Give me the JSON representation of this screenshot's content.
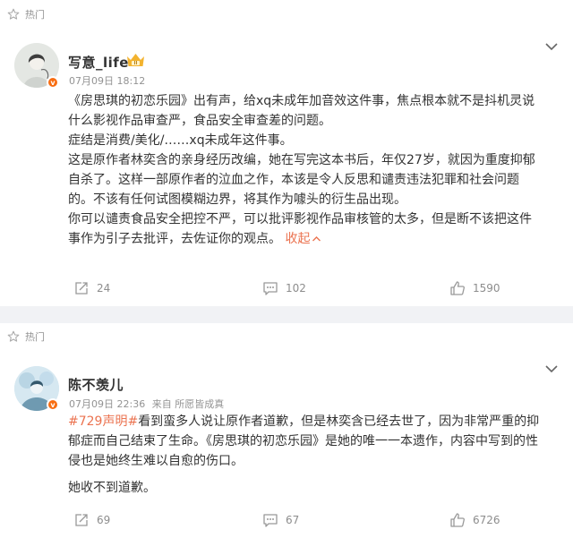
{
  "post1": {
    "hot_label": "热门",
    "username": "写意_life",
    "level_badge": "II",
    "timestamp": "07月09日 18:12",
    "paragraphs": [
      "《房思琪的初恋乐园》出有声，给xq未成年加音效这件事，焦点根本就不是抖机灵说什么影视作品审查严，食品安全审查差的问题。",
      "症结是消费/美化/……xq未成年这件事。",
      "这是原作者林奕含的亲身经历改编，她在写完这本书后，年仅27岁，就因为重度抑郁自杀了。这样一部原作者的泣血之作，本该是令人反思和谴责违法犯罪和社会问题的。不该有任何试图模糊边界，将其作为噱头的衍生品出现。",
      "你可以谴责食品安全把控不严，可以批评影视作品审核管的太多，但是断不该把这件事作为引子去批评，去佐证你的观点。"
    ],
    "fold_label": "收起",
    "reposts": "24",
    "comments": "102",
    "likes": "1590"
  },
  "post2": {
    "hot_label": "热门",
    "username": "陈不羡儿",
    "timestamp": "07月09日 22:36",
    "source": "来自 所愿皆成真",
    "hashtag": "#729声明#",
    "paragraph1_rest": "看到蛮多人说让原作者道歉，但是林奕含已经去世了，因为非常严重的抑郁症而自己结束了生命。《房思琪的初恋乐园》是她的唯一一本遗作，内容中写到的性侵也是她终生难以自愈的伤口。",
    "paragraph2": "她收不到道歉。",
    "reposts": "69",
    "comments": "67",
    "likes": "6726"
  },
  "colors": {
    "accent": "#eb7350",
    "gray_text": "#939393",
    "badge_orange": "#f86d11",
    "background": "#f1f2f5"
  }
}
